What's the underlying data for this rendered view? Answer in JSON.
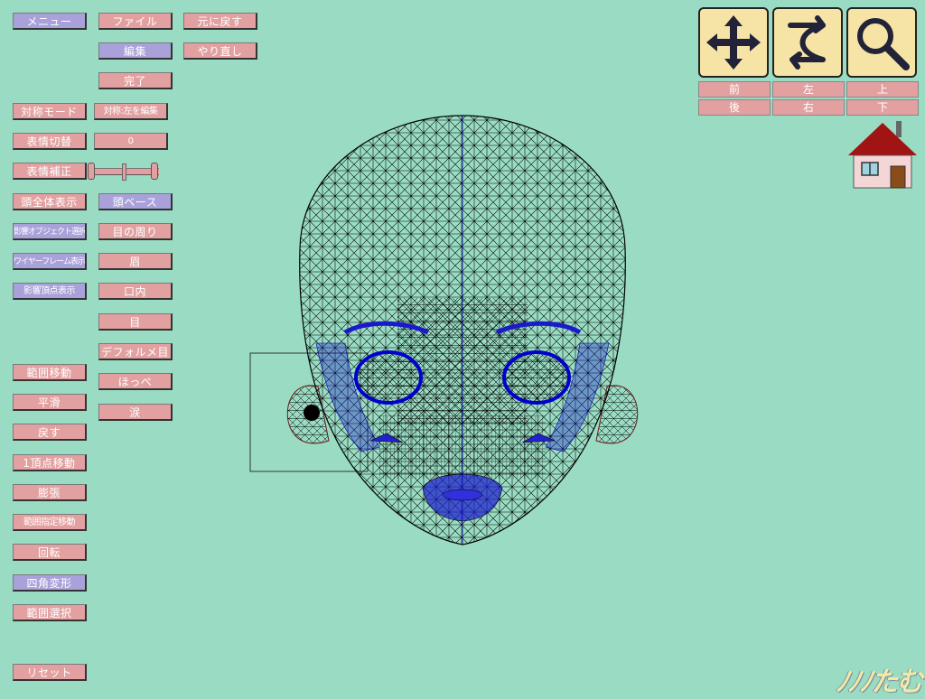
{
  "left_buttons": {
    "menu": "メニュー",
    "symmetry_mode": "対称モード",
    "expression_switch": "表情切替",
    "expression_correct": "表情補正",
    "show_whole_head": "頭全体表示",
    "affected_object_select": "影響オブジェクト選択",
    "wireframe_display": "ワイヤーフレーム表示",
    "affected_vertex_display": "影響頂点表示",
    "range_move": "範囲移動",
    "smooth": "平滑",
    "restore": "戻す",
    "single_vertex_move": "1頂点移動",
    "expand": "膨張",
    "range_specified_move": "範囲指定移動",
    "rotate": "回転",
    "quad_transform": "四角変形",
    "range_select": "範囲選択",
    "reset": "リセット"
  },
  "middle_buttons": {
    "file": "ファイル",
    "edit": "編集",
    "done": "完了",
    "symmetry_edit_left": "対称:左を編集",
    "expression_value": "0",
    "head_base": "頭ベース",
    "around_eyes": "目の周り",
    "eyebrow": "眉",
    "inside_mouth": "口内",
    "eye": "目",
    "deformed_eye": "デフォルメ目",
    "cheek": "ほっぺ",
    "tears": "涙"
  },
  "history_buttons": {
    "undo": "元に戻す",
    "redo": "やり直し"
  },
  "view_controls": {
    "icons": [
      "move-icon",
      "rotate-icon",
      "zoom-icon"
    ],
    "front": "前",
    "left": "左",
    "top": "上",
    "back": "後",
    "right": "右",
    "bottom": "下"
  },
  "expression_correct_slider": {
    "value": 0.5
  },
  "logo_text": "ﾉﾉﾉたむ",
  "colors": {
    "background": "#99dcc3",
    "button_pink": "#e3a0a0",
    "button_purple": "#a9a1d9",
    "wireframe": "#000000",
    "highlight_mesh": "#0000cc"
  }
}
